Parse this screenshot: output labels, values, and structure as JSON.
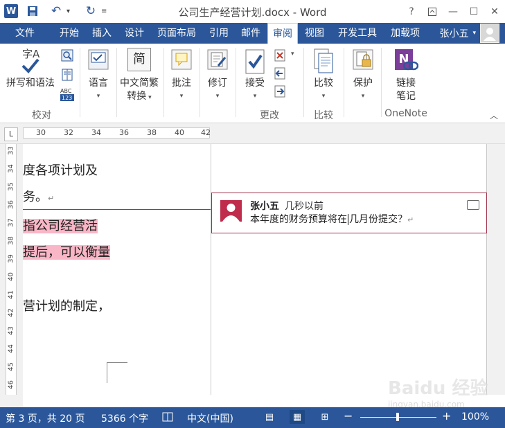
{
  "window": {
    "title": "公司生产经营计划.docx - Word",
    "app_icon": "W",
    "help": "?",
    "controls": [
      "restore-ribbon-icon",
      "minimize-icon",
      "maximize-icon",
      "close-icon"
    ]
  },
  "tabs": [
    "文件",
    "开始",
    "插入",
    "设计",
    "页面布局",
    "引用",
    "邮件",
    "审阅",
    "视图",
    "开发工具",
    "加载项"
  ],
  "active_tab": "审阅",
  "user": {
    "name": "张小五"
  },
  "ribbon": {
    "groups": {
      "proofing": "校对",
      "changes": "更改",
      "compare": "比较",
      "onenote": "OneNote"
    },
    "buttons": {
      "spelling": "拼写和语法",
      "spelling_glyph": "字A",
      "language": "语言",
      "convert_line1": "中文简繁",
      "convert_line2": "转换",
      "convert_glyph": "简",
      "comment": "批注",
      "track": "修订",
      "accept": "接受",
      "compare": "比较",
      "protect": "保护",
      "onenote_line1": "链接",
      "onenote_line2": "笔记",
      "onenote_glyph": "N"
    },
    "colors": {
      "accent": "#2b579a",
      "onenote": "#7b3f9a"
    }
  },
  "ruler": {
    "corner": "L",
    "ticks": [
      "30",
      "32",
      "34",
      "36",
      "38",
      "40",
      "42"
    ],
    "vertical": [
      "33",
      "34",
      "35",
      "36",
      "37",
      "38",
      "39",
      "40",
      "41",
      "42",
      "43",
      "44",
      "45",
      "46"
    ]
  },
  "document": {
    "lines": [
      "度各项计划及",
      "务。",
      "指公司经营活",
      "提后，可以衡量",
      "营计划的制定，"
    ],
    "para_mark": "↵"
  },
  "comment": {
    "author": "张小五",
    "time": "几秒以前",
    "text_before": "本年度的财务预算将在",
    "text_after": "几月份提交？",
    "accent": "#a0324b"
  },
  "status": {
    "page": "第 3 页，共 20 页",
    "words": "5366 个字",
    "language": "中文(中国)",
    "zoom": "100%",
    "zoom_level": 100
  },
  "watermark": {
    "brand": "Baidu 经验",
    "url": "jingyan.baidu.com"
  }
}
